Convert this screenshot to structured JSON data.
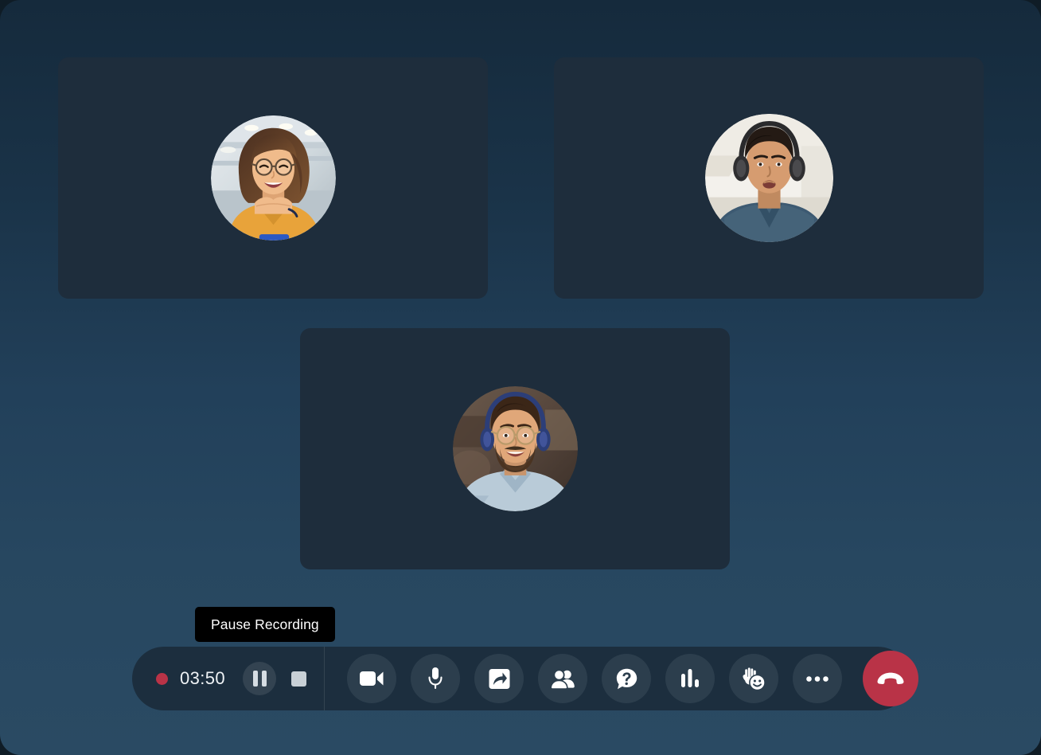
{
  "app": {
    "name": "video-conference-call",
    "background_top_color": "#152a3c",
    "background_bottom_color": "#2a4a63"
  },
  "tooltip": {
    "label": "Pause Recording",
    "background_color": "#000000",
    "text_color": "#ffffff"
  },
  "recording": {
    "indicator_color": "#b93347",
    "elapsed_time": "03:50",
    "pause_label": "Pause Recording",
    "stop_label": "Stop Recording"
  },
  "tiles": [
    {
      "id": "tile-1",
      "participant": "woman-in-yellow-blouse-with-glasses",
      "avatar_shape": "circle",
      "background_color": "#1e2d3c"
    },
    {
      "id": "tile-2",
      "participant": "man-with-black-headphones-blue-vneck",
      "avatar_shape": "circle",
      "background_color": "#1e2d3c"
    },
    {
      "id": "tile-3",
      "participant": "bearded-man-with-glasses-and-blue-headphones",
      "avatar_shape": "circle",
      "background_color": "#1e2d3c"
    }
  ],
  "toolbar": {
    "background_color": "#1c2e3e",
    "button_color": "#2c3e4d",
    "end_call_color": "#b93347",
    "buttons": [
      {
        "name": "camera",
        "icon": "video-camera-icon",
        "label": "Camera"
      },
      {
        "name": "microphone",
        "icon": "microphone-icon",
        "label": "Microphone"
      },
      {
        "name": "share-screen",
        "icon": "share-screen-icon",
        "label": "Share Screen"
      },
      {
        "name": "participants",
        "icon": "participants-icon",
        "label": "Participants"
      },
      {
        "name": "qa",
        "icon": "question-bubble-icon",
        "label": "Q&A"
      },
      {
        "name": "polls",
        "icon": "bar-chart-icon",
        "label": "Polls"
      },
      {
        "name": "reactions",
        "icon": "raise-hand-smiley-icon",
        "label": "Reactions"
      },
      {
        "name": "more-options",
        "icon": "ellipsis-icon",
        "label": "More Options"
      },
      {
        "name": "end-call",
        "icon": "phone-hangup-icon",
        "label": "End Call"
      }
    ]
  }
}
